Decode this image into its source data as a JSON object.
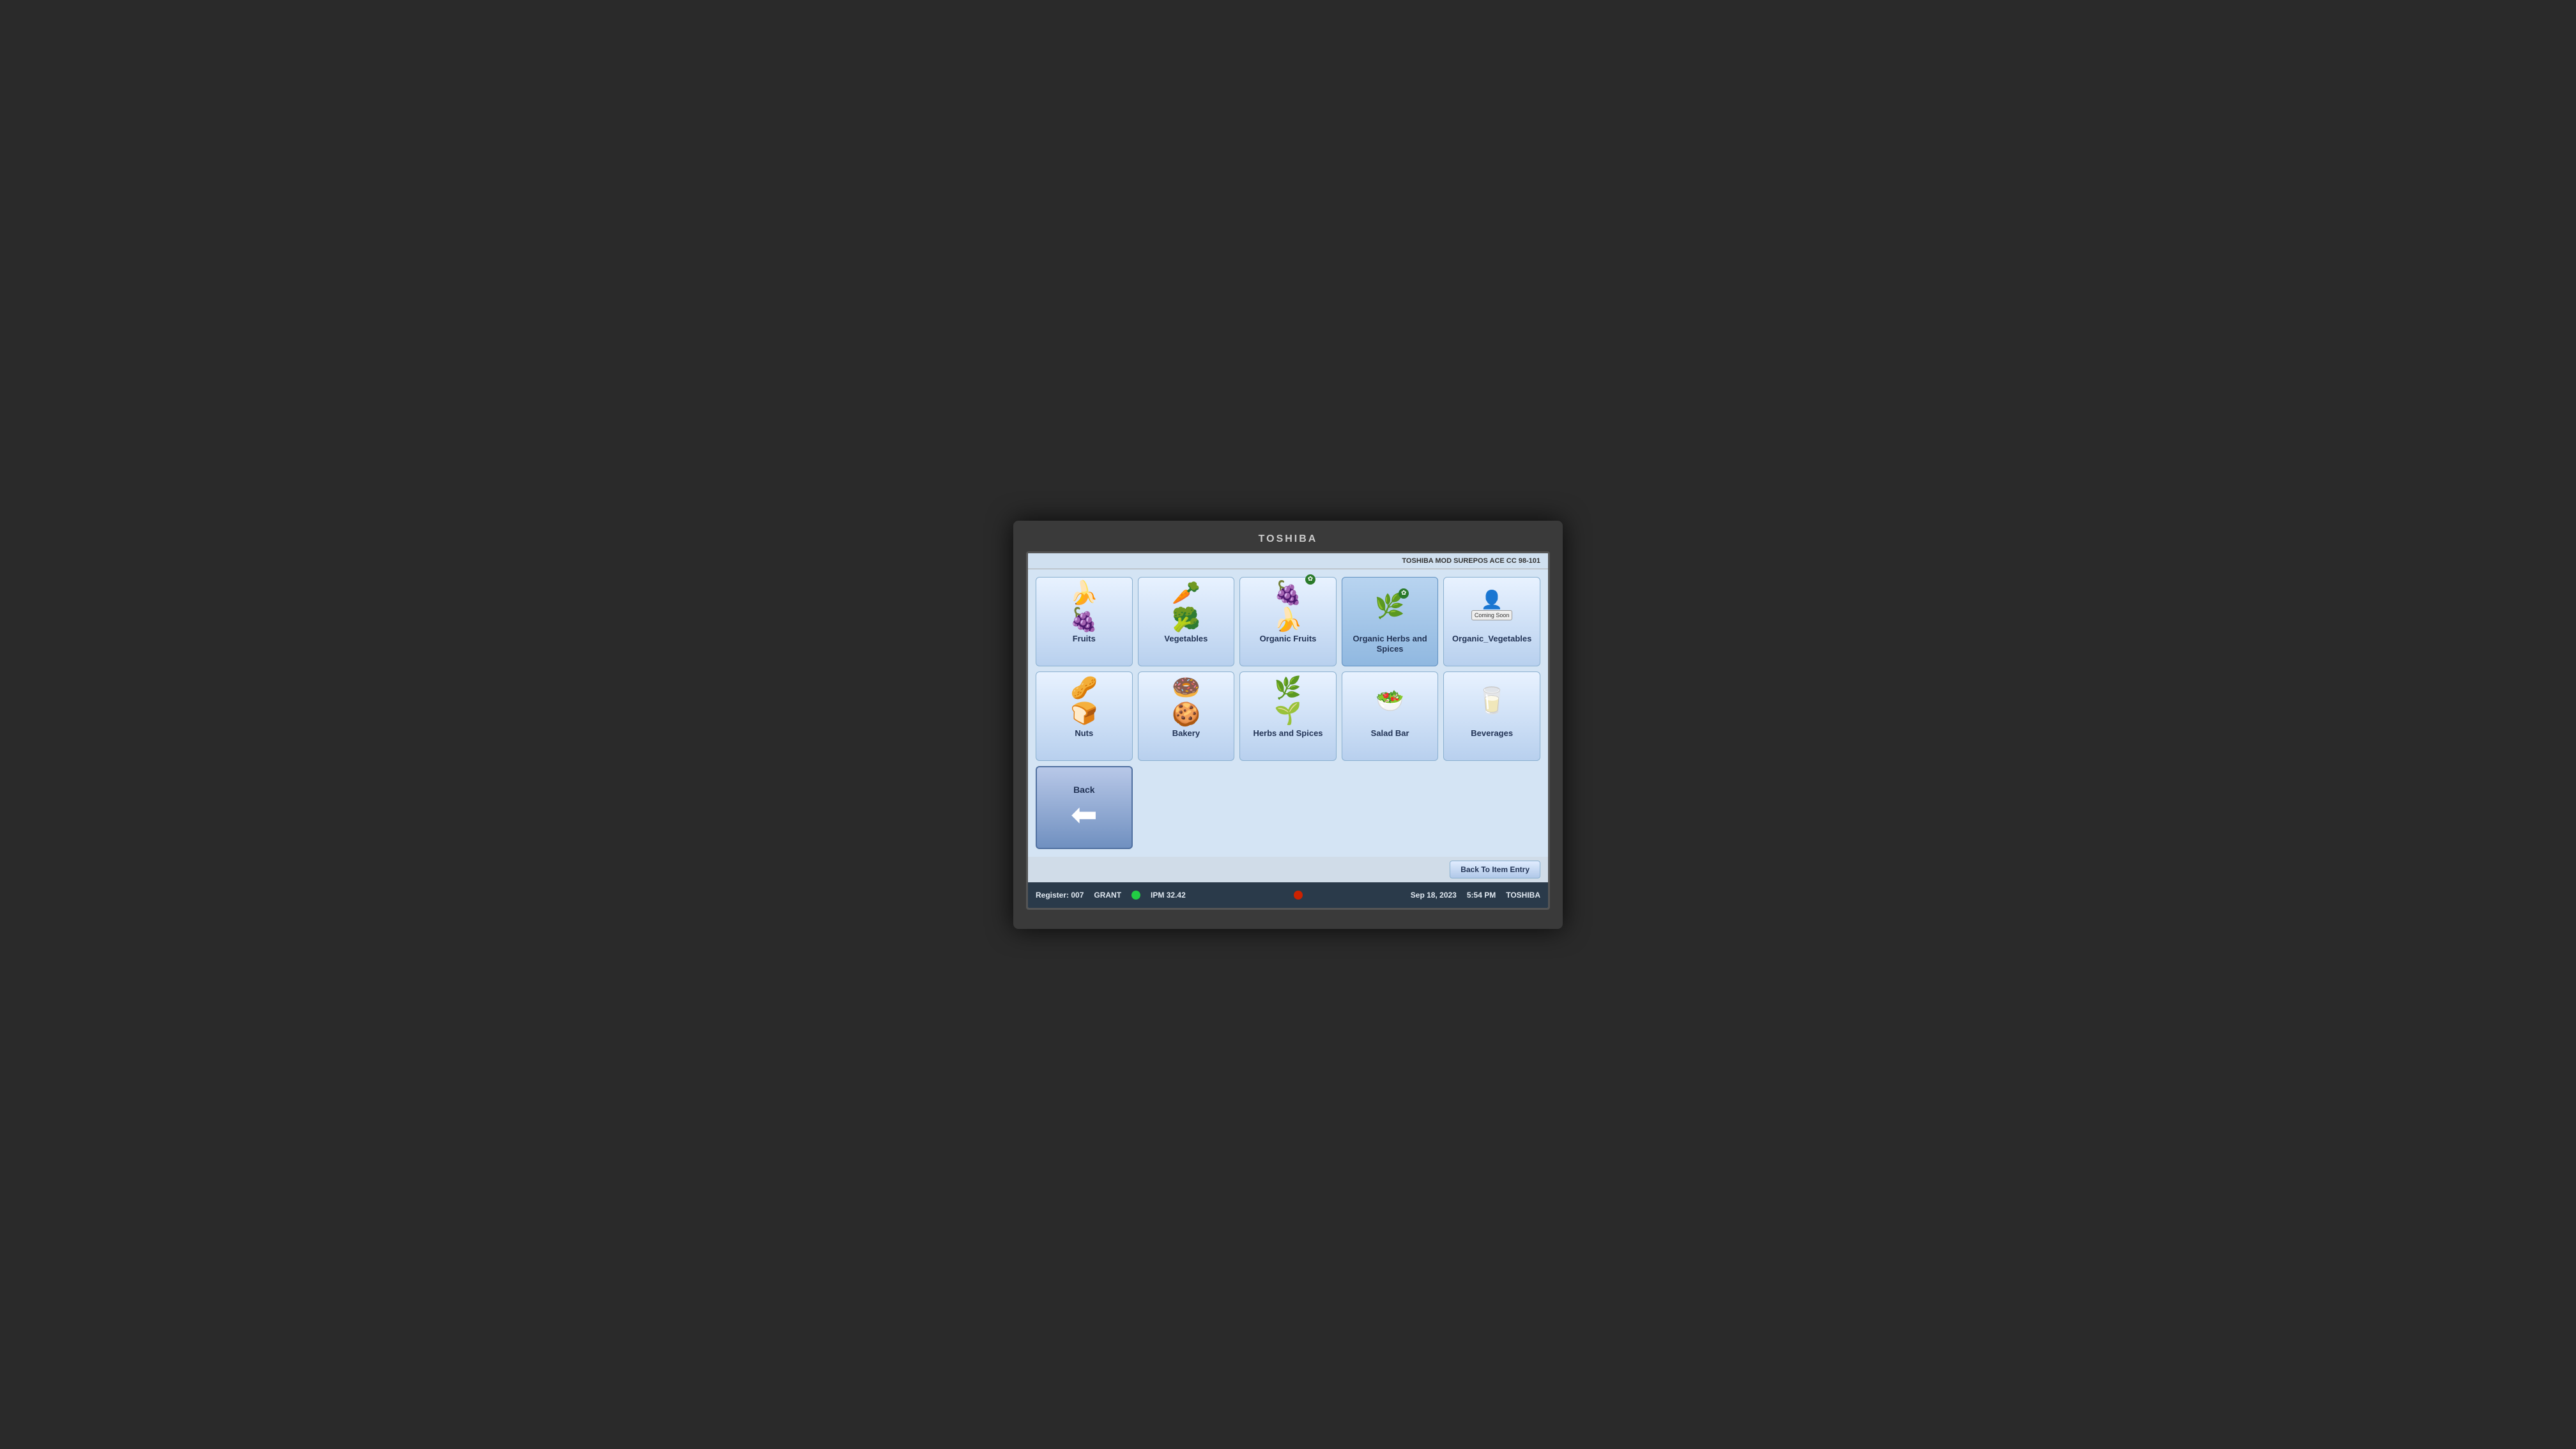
{
  "brand": "TOSHIBA",
  "system_info": "TOSHIBA MOD SUREPOS ACE CC 98-101",
  "categories_row1": [
    {
      "id": "fruits",
      "label": "Fruits",
      "icon": "🍌🍇🍊",
      "active": false
    },
    {
      "id": "vegetables",
      "label": "Vegetables",
      "icon": "🥕🥦🍆",
      "active": false
    },
    {
      "id": "organic-fruits",
      "label": "Organic Fruits",
      "icon": "🍇🍌",
      "organic": true,
      "active": false
    },
    {
      "id": "organic-herbs",
      "label": "Organic Herbs and Spices",
      "icon": "🌿",
      "organic": true,
      "active": true
    },
    {
      "id": "organic-vegetables",
      "label": "Organic_Vegetables",
      "icon": "coming-soon",
      "active": false
    }
  ],
  "categories_row2": [
    {
      "id": "nuts",
      "label": "Nuts",
      "icon": "🥜",
      "active": false
    },
    {
      "id": "bakery",
      "label": "Bakery",
      "icon": "🍩",
      "active": false
    },
    {
      "id": "herbs-spices",
      "label": "Herbs and Spices",
      "icon": "🌿",
      "active": false
    },
    {
      "id": "salad-bar",
      "label": "Salad Bar",
      "icon": "🥗",
      "active": false
    },
    {
      "id": "beverages",
      "label": "Beverages",
      "icon": "🥤",
      "active": false
    }
  ],
  "back_button": {
    "label": "Back"
  },
  "back_to_item_entry": "Back To Item Entry",
  "status_bar": {
    "register": "Register: 007",
    "operator": "GRANT",
    "ipm_label": "IPM 32.42",
    "date": "Sep 18, 2023",
    "time": "5:54 PM",
    "brand": "TOSHIBA"
  }
}
